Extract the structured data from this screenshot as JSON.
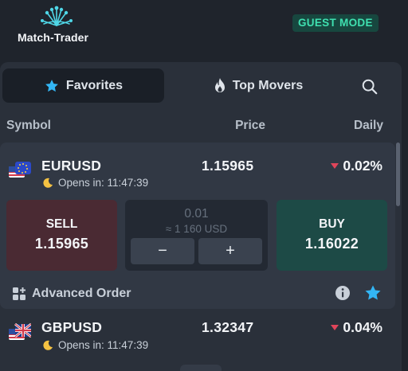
{
  "brand": {
    "name": "Match-Trader"
  },
  "guest_mode": "GUEST MODE",
  "tabs": [
    {
      "label": "Favorites",
      "icon": "star-icon",
      "active": true
    },
    {
      "label": "Top Movers",
      "icon": "flame-icon",
      "active": false
    }
  ],
  "columns": {
    "symbol": "Symbol",
    "price": "Price",
    "daily": "Daily"
  },
  "rows": [
    {
      "symbol": "EURUSD",
      "flag": "eu-us-flag-icon",
      "opens": "Opens in: 11:47:39",
      "price": "1.15965",
      "daily": "0.02%",
      "direction": "down",
      "expanded": true,
      "sell": {
        "label": "SELL",
        "value": "1.15965"
      },
      "buy": {
        "label": "BUY",
        "value": "1.16022"
      },
      "quantity": {
        "amount": "0.01",
        "approx": "≈ 1 160 USD",
        "minus": "−",
        "plus": "+"
      },
      "advanced_order": "Advanced Order"
    },
    {
      "symbol": "GBPUSD",
      "flag": "uk-us-flag-icon",
      "opens": "Opens in: 11:47:39",
      "price": "1.32347",
      "daily": "0.04%",
      "direction": "down",
      "expanded": false
    }
  ],
  "colors": {
    "background": "#1f242c",
    "panel": "#2a303a",
    "accent": "#3fe0b0",
    "sell": "#4a2a33",
    "buy": "#1d4a46",
    "down": "#e0455a",
    "star": "#33b6f5"
  }
}
